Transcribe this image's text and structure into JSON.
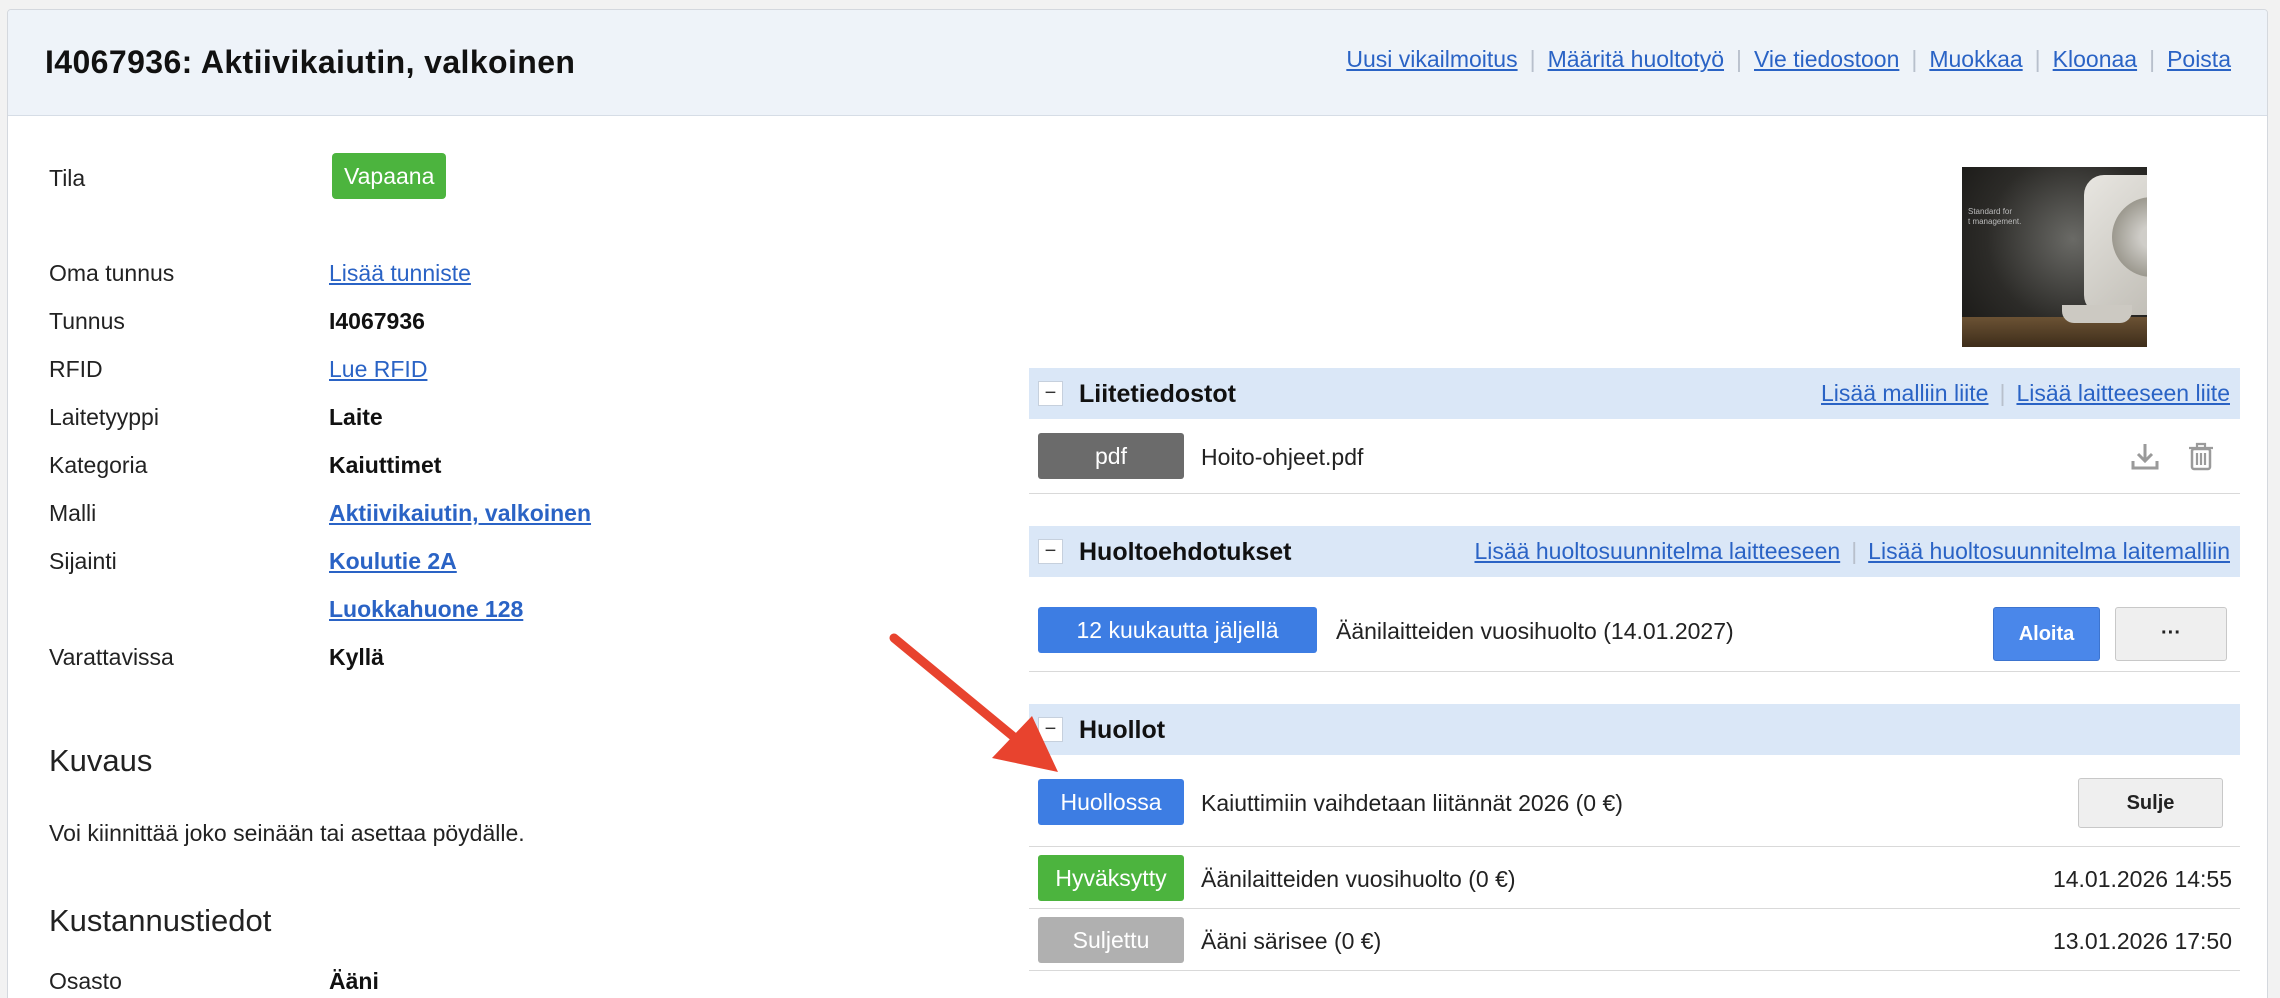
{
  "header": {
    "title": "I4067936: Aktiivikaiutin, valkoinen",
    "actions": [
      "Uusi vikailmoitus",
      "Määritä huoltotyö",
      "Vie tiedostoon",
      "Muokkaa",
      "Kloonaa",
      "Poista"
    ]
  },
  "details": {
    "tila_label": "Tila",
    "tila_value": "Vapaana",
    "oma_tunnus_label": "Oma tunnus",
    "oma_tunnus_value": "Lisää tunniste",
    "tunnus_label": "Tunnus",
    "tunnus_value": "I4067936",
    "rfid_label": "RFID",
    "rfid_value": "Lue RFID",
    "laitetyyppi_label": "Laitetyyppi",
    "laitetyyppi_value": "Laite",
    "kategoria_label": "Kategoria",
    "kategoria_value": "Kaiuttimet",
    "malli_label": "Malli",
    "malli_value": "Aktiivikaiutin, valkoinen",
    "sijainti_label": "Sijainti",
    "sijainti_value_1": "Koulutie 2A",
    "sijainti_value_2": "Luokkahuone 128",
    "varattavissa_label": "Varattavissa",
    "varattavissa_value": "Kyllä"
  },
  "kuvaus": {
    "heading": "Kuvaus",
    "text": "Voi kiinnittää joko seinään tai asettaa pöydälle."
  },
  "kustannus": {
    "heading": "Kustannustiedot",
    "osasto_label": "Osasto",
    "osasto_value": "Ääni"
  },
  "photo": {
    "caption_line1": "Standard for",
    "caption_line2": "t management."
  },
  "attachments": {
    "title": "Liitetiedostot",
    "toggle": "−",
    "actions": [
      "Lisää malliin liite",
      "Lisää laitteeseen liite"
    ],
    "items": [
      {
        "type": "pdf",
        "name": "Hoito-ohjeet.pdf"
      }
    ]
  },
  "suggestions": {
    "title": "Huoltoehdotukset",
    "toggle": "−",
    "actions": [
      "Lisää huoltosuunnitelma laitteeseen",
      "Lisää huoltosuunnitelma laitemalliin"
    ],
    "items": [
      {
        "badge": "12 kuukautta jäljellä",
        "text": "Äänilaitteiden vuosihuolto (14.01.2027)",
        "start": "Aloita",
        "more": "···"
      }
    ]
  },
  "services": {
    "title": "Huollot",
    "toggle": "−",
    "items": [
      {
        "status": "Huollossa",
        "text": "Kaiuttimiin vaihdetaan liitännät 2026 (0 €)",
        "action": "Sulje",
        "color": "#3d7de3"
      },
      {
        "status": "Hyväksytty",
        "text": "Äänilaitteiden vuosihuolto (0 €)",
        "date": "14.01.2026 14:55",
        "color": "#4cb43e"
      },
      {
        "status": "Suljettu",
        "text": "Ääni särisee (0 €)",
        "date": "13.01.2026 17:50",
        "color": "#b0b0b0"
      }
    ]
  },
  "colors": {
    "accent": "#2a63c5",
    "success": "#4cb43e",
    "primary": "#3d7de3",
    "arrow": "#e8432e"
  }
}
